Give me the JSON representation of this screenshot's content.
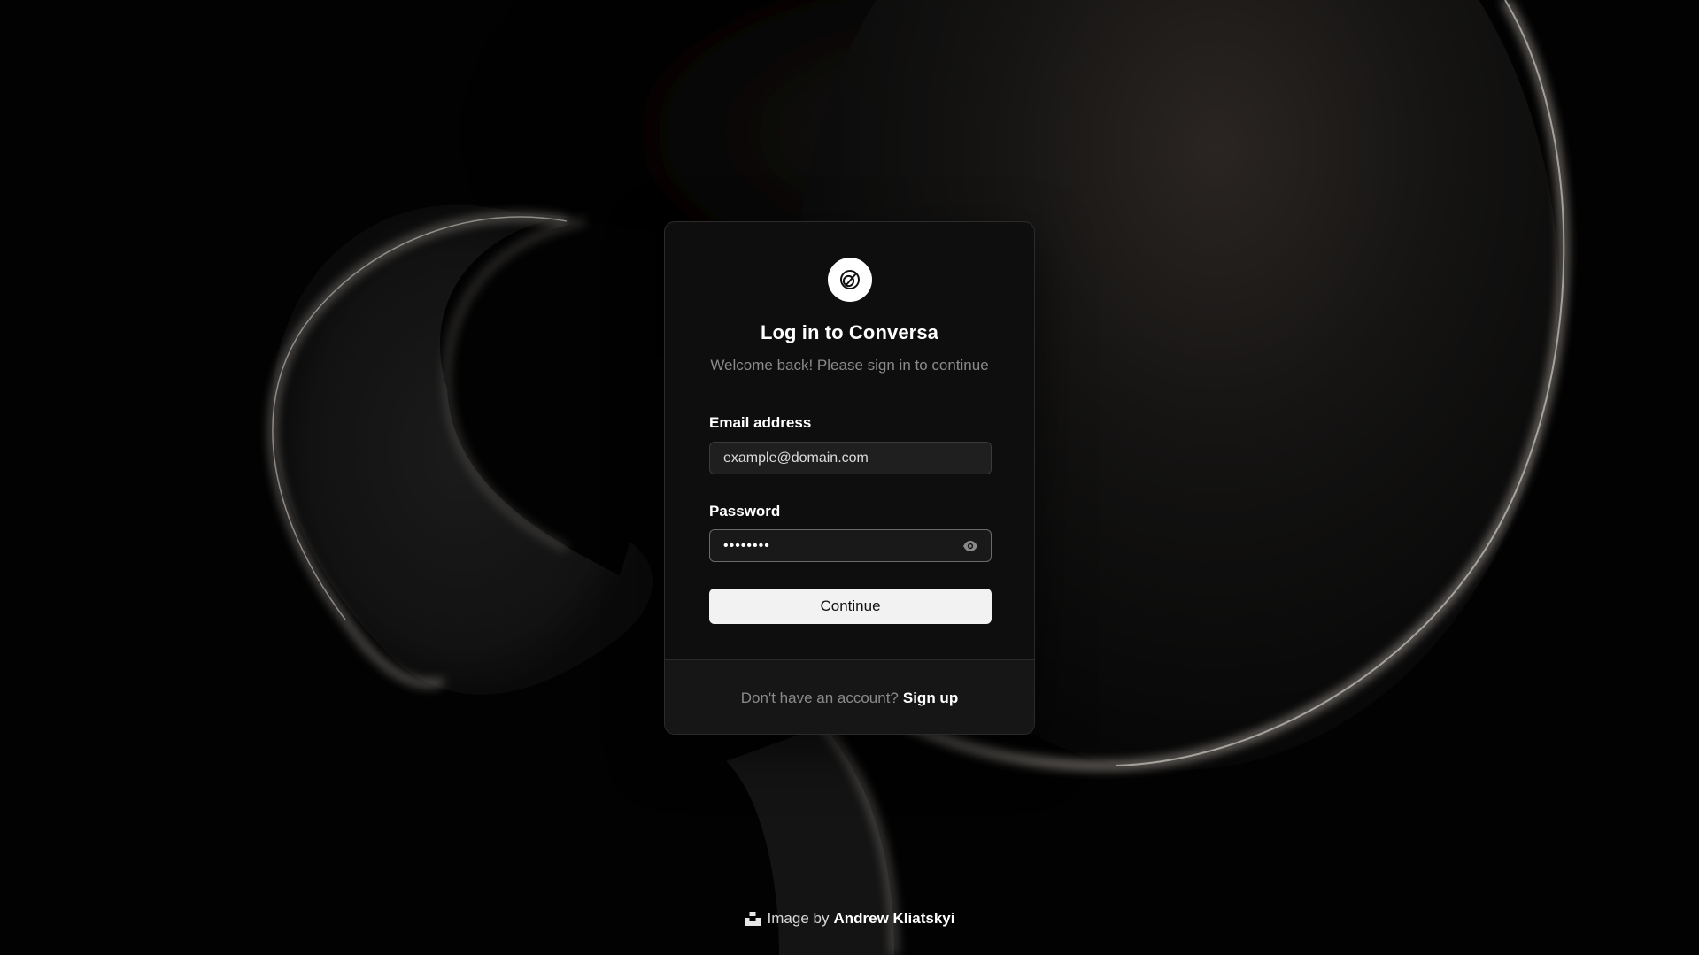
{
  "login": {
    "title": "Log in to Conversa",
    "subtitle": "Welcome back! Please sign in to continue",
    "logo_icon": "overlapping-circles-icon",
    "email": {
      "label": "Email address",
      "value": "example@domain.com",
      "placeholder": "example@domain.com"
    },
    "password": {
      "label": "Password",
      "value": "password",
      "toggle_icon": "eye-icon"
    },
    "continue_label": "Continue",
    "footer": {
      "prompt": "Don't have an account?",
      "signup_label": "Sign up"
    }
  },
  "credit": {
    "icon": "unsplash-icon",
    "prefix": "Image by",
    "author": "Andrew Kliatskyi"
  },
  "colors": {
    "background": "#020202",
    "card": "#0e0e0e",
    "card_footer": "#161616",
    "button": "#f2f2f2",
    "muted_text": "#8a8a8a"
  }
}
